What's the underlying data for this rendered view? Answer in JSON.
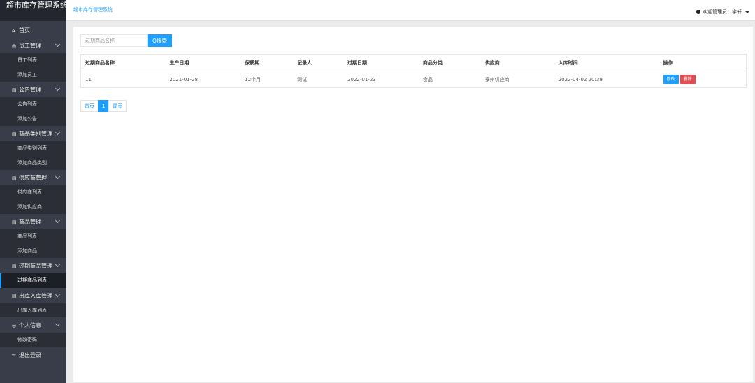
{
  "app_title": "超市库存管理系统",
  "breadcrumb": "超市库存管理系统",
  "user_greeting": "欢迎管理员：李轩",
  "sidebar": {
    "groups": [
      {
        "icon": "⌂",
        "label": "首页",
        "has_chevron": false,
        "items": []
      },
      {
        "icon": "◎",
        "label": "员工管理",
        "has_chevron": true,
        "items": [
          "员工列表",
          "添加员工"
        ]
      },
      {
        "icon": "▤",
        "label": "公告管理",
        "has_chevron": true,
        "items": [
          "公告列表",
          "添加公告"
        ]
      },
      {
        "icon": "▤",
        "label": "商品类别管理",
        "has_chevron": true,
        "items": [
          "商品类别列表",
          "添加商品类别"
        ]
      },
      {
        "icon": "▤",
        "label": "供应商管理",
        "has_chevron": true,
        "items": [
          "供应商列表",
          "添加供应商"
        ]
      },
      {
        "icon": "▤",
        "label": "商品管理",
        "has_chevron": true,
        "items": [
          "商品列表",
          "添加商品"
        ]
      },
      {
        "icon": "▤",
        "label": "过期商品管理",
        "has_chevron": true,
        "items": [
          "过期商品列表"
        ]
      },
      {
        "icon": "▤",
        "label": "出库入库管理",
        "has_chevron": true,
        "items": [
          "出库入库列表"
        ]
      },
      {
        "icon": "◎",
        "label": "个人信息",
        "has_chevron": true,
        "items": [
          "修改密码"
        ]
      },
      {
        "icon": "←",
        "label": "退出登录",
        "has_chevron": false,
        "items": []
      }
    ],
    "active_item": "过期商品列表"
  },
  "search": {
    "placeholder": "过期商品名称",
    "button_label": "Q搜索"
  },
  "table": {
    "headers": [
      "过期商品名称",
      "生产日期",
      "保质期",
      "记录人",
      "过期日期",
      "商品分类",
      "供应商",
      "入库时间",
      "操作"
    ],
    "rows": [
      [
        "11",
        "2021-01-28",
        "12个月",
        "测试",
        "2022-01-23",
        "食品",
        "泰州供应商",
        "2022-04-02 20:39"
      ]
    ],
    "edit_label": "修改",
    "delete_label": "删除"
  },
  "pager": {
    "first": "首页",
    "current": "1",
    "last": "尾页"
  },
  "colors": {
    "sidebar_bg": "#393d49",
    "accent": "#1e9fff",
    "danger": "#e64a52"
  }
}
